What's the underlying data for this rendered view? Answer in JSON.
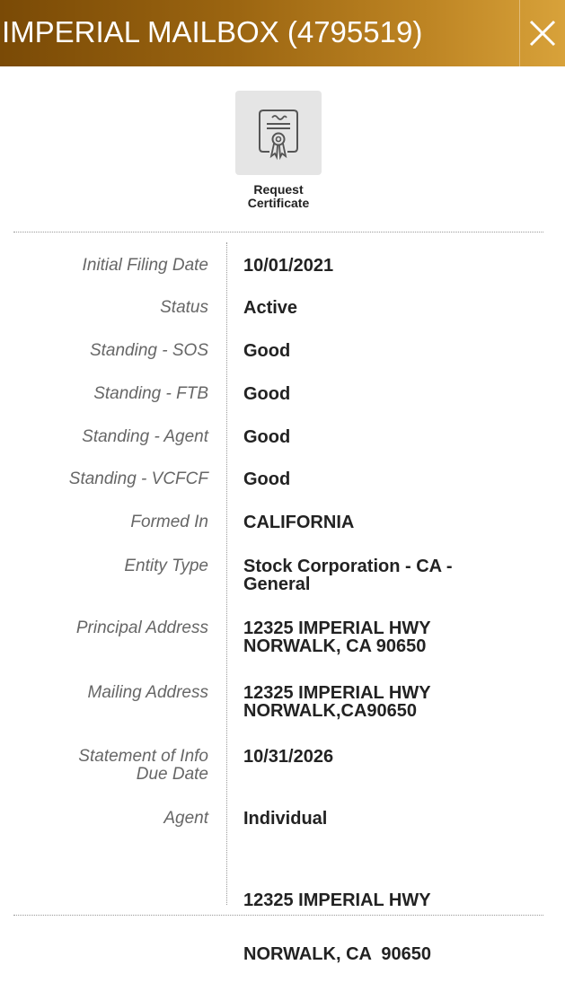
{
  "header": {
    "title": "IMPERIAL MAILBOX (4795519)",
    "close_icon": "close-icon",
    "gradient_colors": [
      "#7a4a06",
      "#d8a23a"
    ]
  },
  "actions": {
    "request_certificate": {
      "label_line1": "Request",
      "label_line2": "Certificate",
      "icon": "certificate-icon"
    }
  },
  "details": {
    "initial_filing_date": {
      "label": "Initial Filing Date",
      "value": "10/01/2021"
    },
    "status": {
      "label": "Status",
      "value": "Active"
    },
    "standing_sos": {
      "label": "Standing - SOS",
      "value": "Good"
    },
    "standing_ftb": {
      "label": "Standing - FTB",
      "value": "Good"
    },
    "standing_agent": {
      "label": "Standing - Agent",
      "value": "Good"
    },
    "standing_vcfcf": {
      "label": "Standing - VCFCF",
      "value": "Good"
    },
    "formed_in": {
      "label": "Formed In",
      "value": "CALIFORNIA"
    },
    "entity_type": {
      "label": "Entity Type",
      "line1": "Stock Corporation - CA -",
      "line2": "General"
    },
    "principal_address": {
      "label": "Principal Address",
      "line1": "12325 IMPERIAL HWY",
      "line2": "NORWALK, CA 90650"
    },
    "mailing_address": {
      "label": "Mailing Address",
      "line1": "12325 IMPERIAL HWY",
      "line2": "NORWALK,CA90650"
    },
    "statement_of_info": {
      "label_line1": "Statement of Info",
      "label_line2": "Due Date",
      "value": "10/31/2026"
    },
    "agent": {
      "label": "Agent",
      "value": "Individual",
      "address_line1": "12325 IMPERIAL HWY",
      "address_line2": "NORWALK, CA  90650"
    }
  }
}
